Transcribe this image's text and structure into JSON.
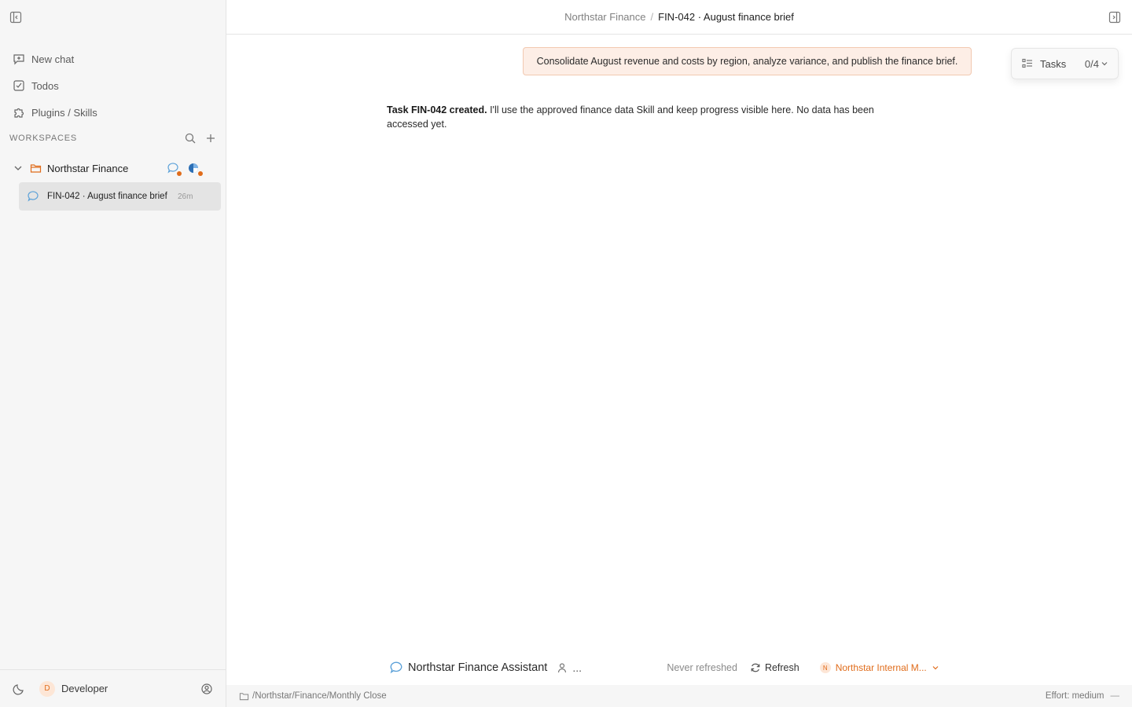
{
  "sidebar": {
    "nav": [
      {
        "label": "New chat",
        "icon": "new-chat-icon"
      },
      {
        "label": "Todos",
        "icon": "todos-icon"
      },
      {
        "label": "Plugins / Skills",
        "icon": "puzzle-icon"
      }
    ],
    "workspaces_title": "WORKSPACES",
    "workspace": {
      "name": "Northstar Finance"
    },
    "chat": {
      "label": "FIN-042 · August finance brief",
      "time": "26m"
    },
    "user": {
      "initial": "D",
      "name": "Developer"
    }
  },
  "header": {
    "breadcrumb_parent": "Northstar Finance",
    "breadcrumb_sep": "/",
    "breadcrumb_current": "FIN-042 · August finance brief"
  },
  "conversation": {
    "user_message": "Consolidate August revenue and costs by region, analyze variance, and publish the finance brief.",
    "assistant_bold": "Task FIN-042 created.",
    "assistant_text": " I'll use the approved finance data Skill and keep progress visible here. No data has been accessed yet."
  },
  "tasks": {
    "label": "Tasks",
    "count": "0/4"
  },
  "composer": {
    "assistant_name": "Northstar Finance Assistant",
    "more": "...",
    "refresh_status": "Never refreshed",
    "refresh_label": "Refresh",
    "model_initial": "N",
    "model_name": "Northstar Internal M..."
  },
  "status": {
    "path": "/Northstar/Finance/Monthly Close",
    "effort": "Effort: medium",
    "dash": "—"
  },
  "colors": {
    "accent": "#e06c1b",
    "chat_icon": "#5aa0d8",
    "user_bubble": "#fdeee6"
  }
}
